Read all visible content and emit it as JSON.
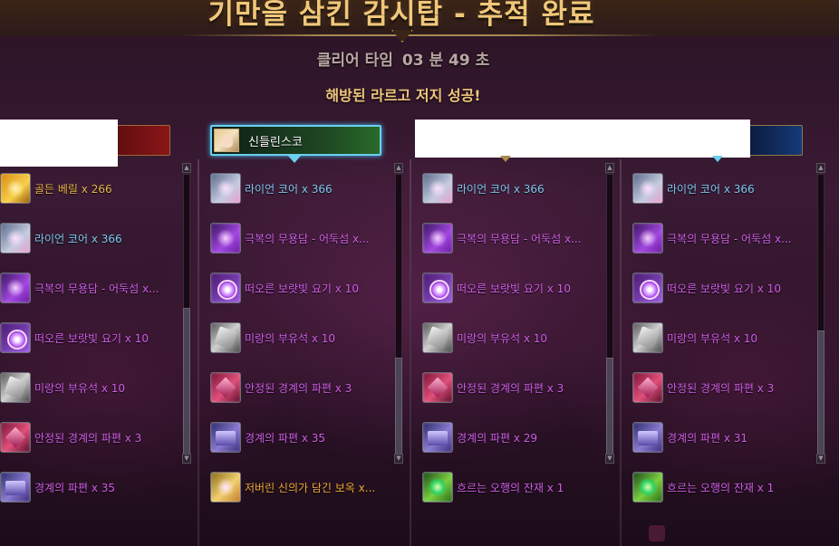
{
  "header": {
    "title": "기만을 삼킨 감시탑 - 추적 완료",
    "clear_time_label": "클리어 타임",
    "clear_time_value": "03 분 49 초",
    "message": "해방된 라르고 저지 성공!"
  },
  "players": [
    {
      "name": "",
      "bar_color": "#8a1616"
    },
    {
      "name": "신들린스코",
      "bar_color": "#2a6a2a"
    },
    {
      "name": "",
      "bar_color": "#163a78"
    },
    {
      "name": "",
      "bar_color": "#163a78"
    }
  ],
  "columns": [
    {
      "items": [
        {
          "icon": "golden-beryl-icon",
          "label": "골든 베릴 x 266",
          "color": "#e9b44a"
        },
        {
          "icon": "lion-core-icon",
          "label": "라이언 코어 x 366",
          "color": "#7fc8ee"
        },
        {
          "icon": "glory-tale-icon",
          "label": "극복의 무용담 - 어둑섬 x...",
          "color": "#d05ee8"
        },
        {
          "icon": "light-energy-icon",
          "label": "떠오른 보랏빛 요기 x 10",
          "color": "#d05ee8"
        },
        {
          "icon": "charm-stone-icon",
          "label": "미랑의 부유석 x 10",
          "color": "#d05ee8"
        },
        {
          "icon": "stable-shard-icon",
          "label": "안정된 경계의 파편 x 3",
          "color": "#d05ee8"
        },
        {
          "icon": "boundary-shard-icon",
          "label": "경계의 파편 x 35",
          "color": "#d05ee8"
        }
      ]
    },
    {
      "items": [
        {
          "icon": "lion-core-icon",
          "label": "라이언 코어 x 366",
          "color": "#7fc8ee"
        },
        {
          "icon": "glory-tale-icon",
          "label": "극복의 무용담 - 어둑섬 x...",
          "color": "#d05ee8"
        },
        {
          "icon": "light-energy-icon",
          "label": "떠오른 보랏빛 요기 x 10",
          "color": "#d05ee8"
        },
        {
          "icon": "charm-stone-icon",
          "label": "미랑의 부유석 x 10",
          "color": "#d05ee8"
        },
        {
          "icon": "stable-shard-icon",
          "label": "안정된 경계의 파편 x 3",
          "color": "#d05ee8"
        },
        {
          "icon": "boundary-shard-icon",
          "label": "경계의 파편 x 35",
          "color": "#d05ee8"
        },
        {
          "icon": "wish-jewel-icon",
          "label": "저버린 신의가 담긴 보옥 x...",
          "color": "#f0a838"
        }
      ]
    },
    {
      "items": [
        {
          "icon": "lion-core-icon",
          "label": "라이언 코어 x 366",
          "color": "#7fc8ee"
        },
        {
          "icon": "glory-tale-icon",
          "label": "극복의 무용담 - 어둑섬 x...",
          "color": "#d05ee8"
        },
        {
          "icon": "light-energy-icon",
          "label": "떠오른 보랏빛 요기 x 10",
          "color": "#d05ee8"
        },
        {
          "icon": "charm-stone-icon",
          "label": "미랑의 부유석 x 10",
          "color": "#d05ee8"
        },
        {
          "icon": "stable-shard-icon",
          "label": "안정된 경계의 파편 x 3",
          "color": "#d05ee8"
        },
        {
          "icon": "boundary-shard-icon",
          "label": "경계의 파편 x 29",
          "color": "#d05ee8"
        },
        {
          "icon": "flowing-residue-icon",
          "label": "흐르는 오행의 잔재 x 1",
          "color": "#d05ee8"
        }
      ]
    },
    {
      "items": [
        {
          "icon": "lion-core-icon",
          "label": "라이언 코어 x 366",
          "color": "#7fc8ee"
        },
        {
          "icon": "glory-tale-icon",
          "label": "극복의 무용담 - 어둑섬 x...",
          "color": "#d05ee8"
        },
        {
          "icon": "light-energy-icon",
          "label": "떠오른 보랏빛 요기 x 10",
          "color": "#d05ee8"
        },
        {
          "icon": "charm-stone-icon",
          "label": "미랑의 부유석 x 10",
          "color": "#d05ee8"
        },
        {
          "icon": "stable-shard-icon",
          "label": "안정된 경계의 파편 x 3",
          "color": "#d05ee8"
        },
        {
          "icon": "boundary-shard-icon",
          "label": "경계의 파편 x 31",
          "color": "#d05ee8"
        },
        {
          "icon": "flowing-residue-icon",
          "label": "흐르는 오행의 잔재 x 1",
          "color": "#d05ee8"
        }
      ]
    }
  ]
}
